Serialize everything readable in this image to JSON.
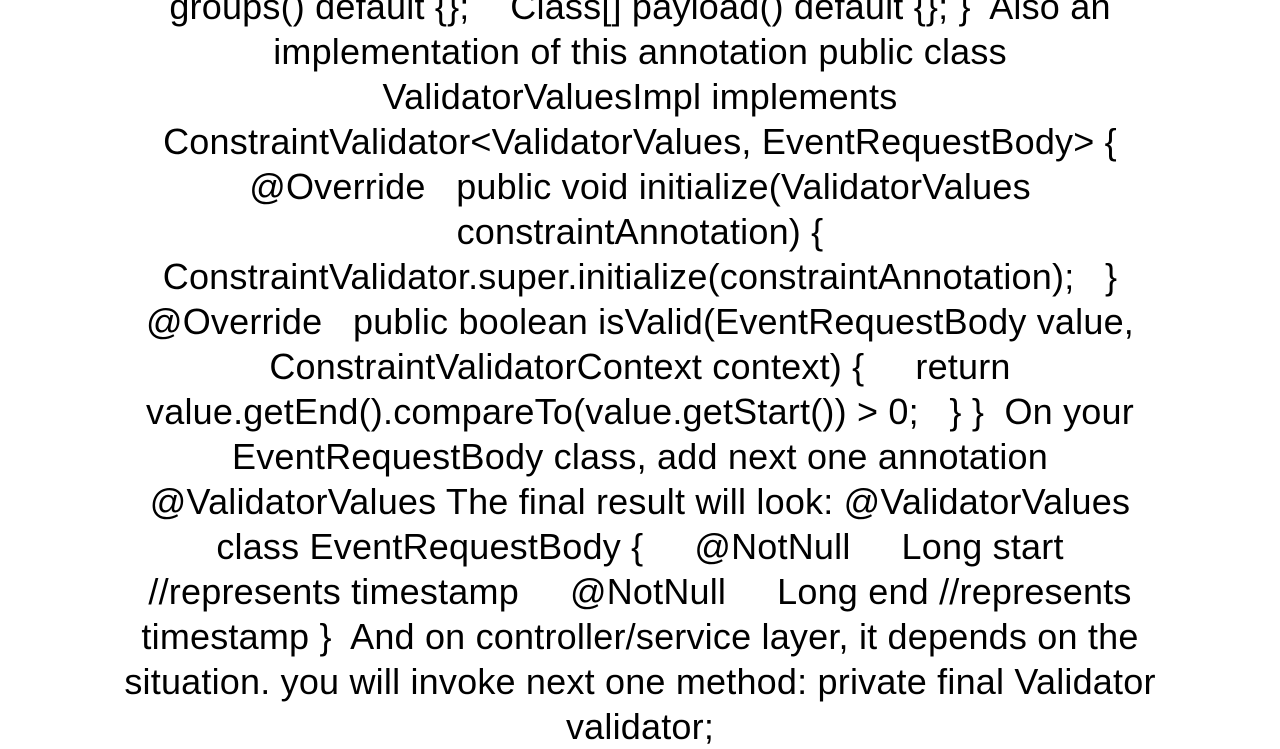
{
  "content": {
    "text": "groups() default {};    Class[] payload() default {}; }  Also an implementation of this annotation public class ValidatorValuesImpl implements ConstraintValidator<ValidatorValues, EventRequestBody> {    @Override   public void initialize(ValidatorValues constraintAnnotation) {     ConstraintValidator.super.initialize(constraintAnnotation);   }    @Override   public boolean isValid(EventRequestBody value, ConstraintValidatorContext context) {     return value.getEnd().compareTo(value.getStart()) > 0;   } }  On your EventRequestBody class, add next one annotation @ValidatorValues The final result will look: @ValidatorValues class EventRequestBody {     @NotNull     Long start //represents timestamp     @NotNull     Long end //represents timestamp }  And on controller/service layer, it depends on the situation. you will invoke next one method: private final Validator validator;"
  }
}
